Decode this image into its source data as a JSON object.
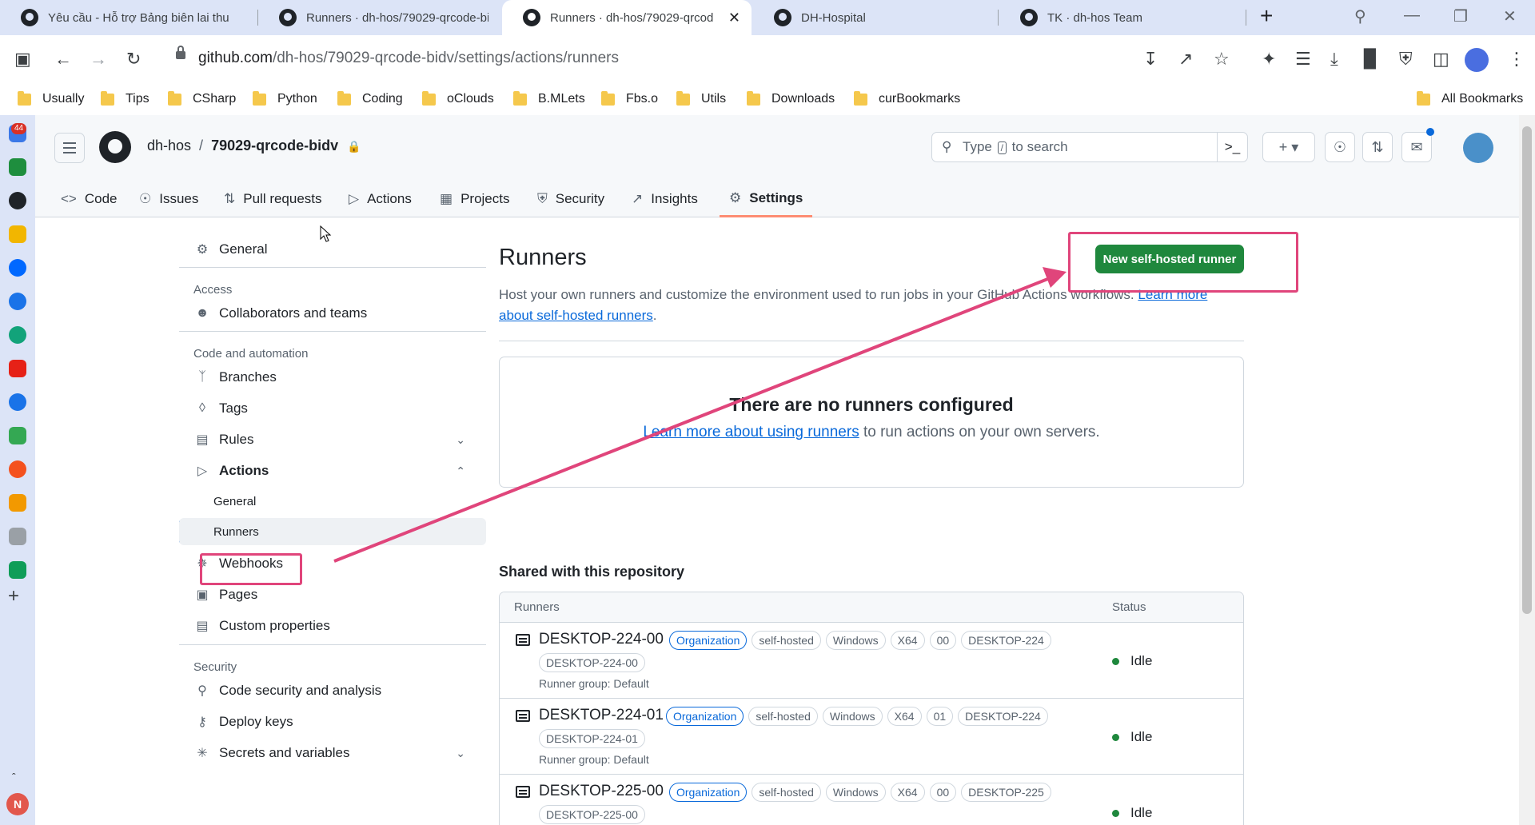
{
  "browser": {
    "tabs": [
      {
        "title": "Yêu cầu - Hỗ trợ Bảng biên lai thu",
        "active": false
      },
      {
        "title": "Runners · dh-hos/79029-qrcode-bi",
        "active": false
      },
      {
        "title": "Runners · dh-hos/79029-qrcod",
        "active": true
      },
      {
        "title": "DH-Hospital",
        "active": false
      },
      {
        "title": "TK · dh-hos Team",
        "active": false
      }
    ],
    "new_tab": "+",
    "url_host": "github.com",
    "url_path": "/dh-hos/79029-qrcode-bidv/settings/actions/runners",
    "bookmarks": [
      "Usually",
      "Tips",
      "CSharp",
      "Python",
      "Coding",
      "oClouds",
      "B.MLets",
      "Fbs.o",
      "Utils",
      "Downloads",
      "curBookmarks"
    ],
    "all_bookmarks": "All Bookmarks",
    "notification_count": "44",
    "profile_letter": "N"
  },
  "header": {
    "owner": "dh-hos",
    "separator": "/",
    "repo": "79029-qrcode-bidv",
    "search_prefix": "Type",
    "search_key": "/",
    "search_suffix": "to search"
  },
  "repo_nav": [
    {
      "label": "Code",
      "icon": "code-icon"
    },
    {
      "label": "Issues",
      "icon": "issue-icon"
    },
    {
      "label": "Pull requests",
      "icon": "pull-request-icon"
    },
    {
      "label": "Actions",
      "icon": "play-icon"
    },
    {
      "label": "Projects",
      "icon": "table-icon"
    },
    {
      "label": "Security",
      "icon": "shield-icon"
    },
    {
      "label": "Insights",
      "icon": "graph-icon"
    },
    {
      "label": "Settings",
      "icon": "gear-icon",
      "active": true
    }
  ],
  "settings_nav": {
    "general": "General",
    "access_heading": "Access",
    "collaborators": "Collaborators and teams",
    "code_heading": "Code and automation",
    "branches": "Branches",
    "tags": "Tags",
    "rules": "Rules",
    "actions": "Actions",
    "actions_general": "General",
    "actions_runners": "Runners",
    "webhooks": "Webhooks",
    "pages": "Pages",
    "custom_properties": "Custom properties",
    "security_heading": "Security",
    "code_security": "Code security and analysis",
    "deploy_keys": "Deploy keys",
    "secrets": "Secrets and variables"
  },
  "main": {
    "title": "Runners",
    "new_button": "New self-hosted runner",
    "desc_text": "Host your own runners and customize the environment used to run jobs in your GitHub Actions workflows.",
    "desc_link": "Learn more about self-hosted runners",
    "desc_end": ".",
    "empty_title": "There are no runners configured",
    "empty_link": "Learn more about using runners",
    "empty_suffix": "to run actions on your own servers.",
    "shared_heading": "Shared with this repository",
    "col_runners": "Runners",
    "col_status": "Status",
    "runners": [
      {
        "name": "DESKTOP-224-00",
        "labels": [
          "Organization",
          "self-hosted",
          "Windows",
          "X64",
          "00",
          "DESKTOP-224"
        ],
        "label2": "DESKTOP-224-00",
        "group": "Runner group: Default",
        "status": "Idle"
      },
      {
        "name": "DESKTOP-224-01",
        "labels": [
          "Organization",
          "self-hosted",
          "Windows",
          "X64",
          "01",
          "DESKTOP-224"
        ],
        "label2": "DESKTOP-224-01",
        "group": "Runner group: Default",
        "status": "Idle"
      },
      {
        "name": "DESKTOP-225-00",
        "labels": [
          "Organization",
          "self-hosted",
          "Windows",
          "X64",
          "00",
          "DESKTOP-225"
        ],
        "label2": "DESKTOP-225-00",
        "group": "",
        "status": "Idle"
      }
    ]
  },
  "colors": {
    "primary_button": "#1f883d",
    "link": "#0969da",
    "annotation": "#e0457b",
    "active_tab_underline": "#fd8c73"
  }
}
